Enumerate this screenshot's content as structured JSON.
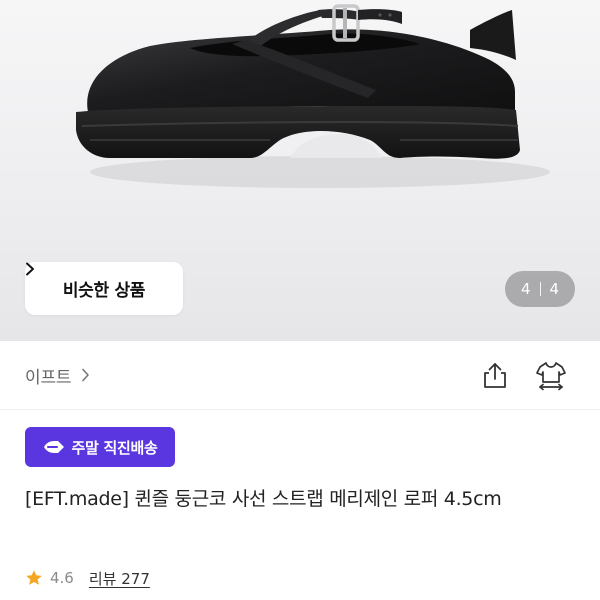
{
  "gallery": {
    "similar_button_label": "비슷한 상품",
    "current_index": "4",
    "total_count": "4"
  },
  "brand": {
    "name": "이프트"
  },
  "badge": {
    "label": "주말 직진배송",
    "color": "#5A36E0"
  },
  "product": {
    "title": "[EFT.made] 퀸즐 둥근코 사선 스트랩 메리제인 로퍼 4.5cm"
  },
  "rating": {
    "score": "4.6",
    "reviews_label": "리뷰 277",
    "star_color": "#F5A623"
  },
  "icons": {
    "similar_chevron": "chevron-right-icon",
    "brand_chevron": "chevron-right-icon",
    "share": "share-icon",
    "fit": "clothing-fit-icon",
    "delivery": "delivery-arrow-icon",
    "rating": "star-icon"
  }
}
